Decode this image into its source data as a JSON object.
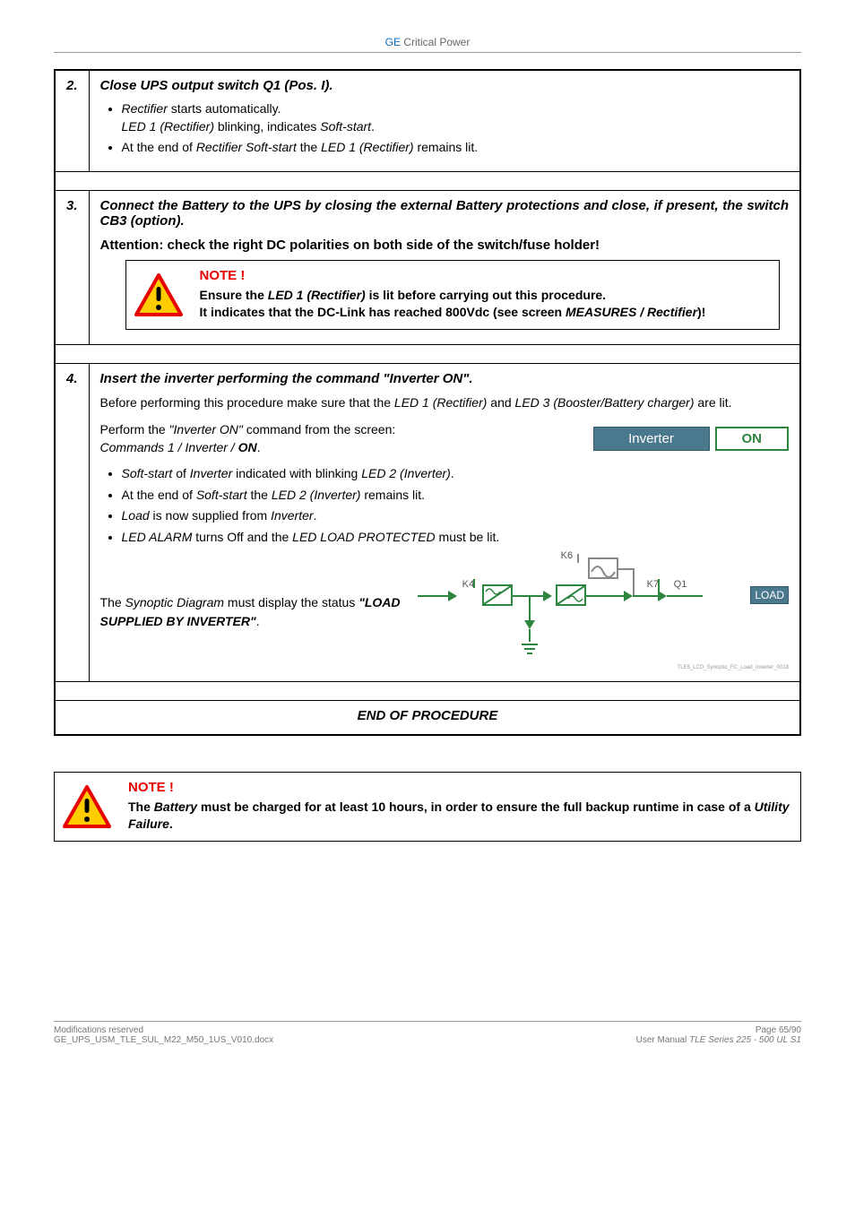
{
  "header": {
    "ge": "GE",
    "cp": " Critical Power"
  },
  "steps": {
    "s2": {
      "num": "2.",
      "title": "Close UPS output switch Q1 (Pos. I).",
      "b1_a": "Rectifier",
      "b1_b": " starts automatically.",
      "sub_a": "LED 1 (Rectifier)",
      "sub_b": " blinking, indicates ",
      "sub_c": "Soft-start",
      "sub_d": ".",
      "b2_a": "At the end of ",
      "b2_b": "Rectifier Soft-start",
      "b2_c": " the ",
      "b2_d": "LED 1 (Rectifier)",
      "b2_e": " remains lit."
    },
    "s3": {
      "num": "3.",
      "title": "Connect the Battery to the UPS by closing the external Battery protections and close, if present, the switch CB3 (option).",
      "attention": "Attention: check the right DC polarities on both side of the switch/fuse holder!",
      "note_title": "NOTE !",
      "note_l1_a": "Ensure the ",
      "note_l1_b": "LED 1 (Rectifier)",
      "note_l1_c": " is lit before carrying out this procedure.",
      "note_l2_a": "It indicates that the DC-Link has reached 800Vdc (see screen ",
      "note_l2_b": "MEASURES / Rectifier",
      "note_l2_c": ")!"
    },
    "s4": {
      "num": "4.",
      "title_a": "Insert the inverter performing the command ",
      "title_b": "\"Inverter ON\".",
      "intro_a": "Before performing this procedure make sure that the ",
      "intro_b": "LED 1 (Rectifier)",
      "intro_c": " and ",
      "intro_d": "LED 3 (Booster/Battery charger)",
      "intro_e": " are lit.",
      "cmd_a": "Perform the ",
      "cmd_b": "\"Inverter ON\"",
      "cmd_c": " command from the screen:",
      "cmd_d": "Commands 1 / Inverter / ",
      "cmd_e": "ON",
      "cmd_f": ".",
      "btn_inverter": "Inverter",
      "btn_on": "ON",
      "b1_a": "Soft-start",
      "b1_b": " of ",
      "b1_c": "Inverter",
      "b1_d": " indicated with blinking ",
      "b1_e": "LED 2 (Inverter)",
      "b1_f": ".",
      "b2_a": "At the end of ",
      "b2_b": "Soft-start",
      "b2_c": " the ",
      "b2_d": "LED 2 (Inverter)",
      "b2_e": " remains lit.",
      "b3_a": "Load",
      "b3_b": " is now supplied from ",
      "b3_c": "Inverter",
      "b3_d": ".",
      "b4_a": "LED ALARM",
      "b4_b": " turns Off and the ",
      "b4_c": "LED LOAD PROTECTED",
      "b4_d": " must be lit.",
      "syn_a": "The ",
      "syn_b": "Synoptic Diagram",
      "syn_c": " must display the status ",
      "syn_d": "\"LOAD SUPPLIED BY INVERTER\"",
      "syn_e": ".",
      "diagram": {
        "k4": "K4",
        "k6": "K6",
        "k7": "K7",
        "q1": "Q1",
        "load": "LOAD",
        "tiny": "TLE5_LCD_Synoptic_FC_Load_Inverter_0018"
      }
    },
    "end": "END OF PROCEDURE"
  },
  "final_note": {
    "title": "NOTE !",
    "l1_a": "The ",
    "l1_b": "Battery",
    "l1_c": " must be charged for at least 10 hours, in order to ensure the full backup runtime in case of a ",
    "l1_d": "Utility Failure",
    "l1_e": "."
  },
  "footer": {
    "left1": "Modifications reserved",
    "left2": "GE_UPS_USM_TLE_SUL_M22_M50_1US_V010.docx",
    "right1": "Page 65/90",
    "right2_a": "User Manual ",
    "right2_b": "TLE Series 225 - 500 UL S1"
  }
}
